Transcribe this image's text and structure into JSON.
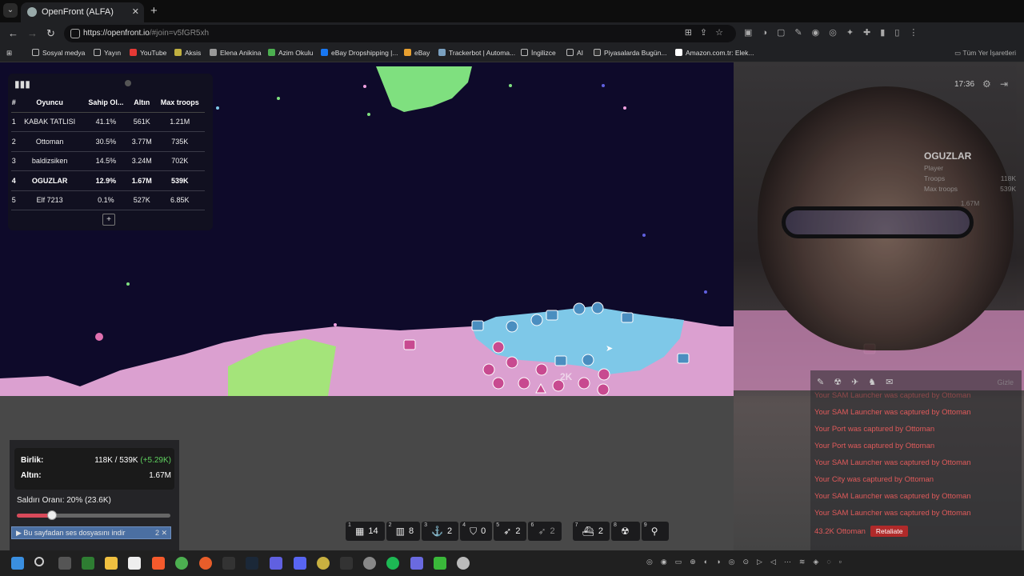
{
  "browser": {
    "tab_title": "OpenFront (ALFA)",
    "url_host": "https://openfront.io",
    "url_path": "/#join=v5fGR5xh",
    "bookmarks": [
      "Sosyal medya",
      "Yayın",
      "YouTube",
      "Aksis",
      "Elena Anikina",
      "Azim Okulu",
      "eBay Dropshipping |...",
      "eBay",
      "Trackerbot | Automa...",
      "İngilizce",
      "AI",
      "Piyasalarda Bugün...",
      "Amazon.com.tr: Elek..."
    ],
    "all_bookmarks": "Tüm Yer İşaretleri"
  },
  "leaderboard": {
    "headers": [
      "#",
      "Oyuncu",
      "Sahip Ol...",
      "Altın",
      "Max troops"
    ],
    "rows": [
      [
        "1",
        "KABAK TATLISI",
        "41.1%",
        "561K",
        "1.21M"
      ],
      [
        "2",
        "Ottoman",
        "30.5%",
        "3.77M",
        "735K"
      ],
      [
        "3",
        "baldizsiken",
        "14.5%",
        "3.24M",
        "702K"
      ],
      [
        "4",
        "OGUZLAR",
        "12.9%",
        "1.67M",
        "539K"
      ],
      [
        "5",
        "Elf 7213",
        "0.1%",
        "527K",
        "6.85K"
      ]
    ],
    "more_label": "+"
  },
  "overlay": {
    "clock": "17:36",
    "player_name": "OGUZLAR",
    "player_type": "Player",
    "troops_label": "Troops",
    "troops_value": "118K",
    "max_troops_label": "Max troops",
    "max_troops_value": "539K",
    "gold_value": "1.67M"
  },
  "events": {
    "hide_label": "Gizle",
    "lines": [
      "Your SAM Launcher was captured by Ottoman",
      "Your SAM Launcher was captured by Ottoman",
      "Your Port was captured by Ottoman",
      "Your Port was captured by Ottoman",
      "Your SAM Launcher was captured by Ottoman",
      "Your City was captured by Ottoman",
      "Your SAM Launcher was captured by Ottoman",
      "Your SAM Launcher was captured by Ottoman"
    ],
    "attack_line": "43.2K Ottoman",
    "retaliate_label": "Retaliate"
  },
  "stats": {
    "troops_label": "Birlik:",
    "troops_value": "118K / 539K",
    "troops_delta": "(+5.29K)",
    "gold_label": "Altın:",
    "gold_value": "1.67M",
    "attack_ratio_text": "Saldırı Oranı: 20% (23.6K)",
    "attack_ratio": 0.2,
    "sound_banner": "Bu sayfadan ses dosyasını indir"
  },
  "map": {
    "center_label": "2K"
  },
  "buildbar": [
    {
      "key": "1",
      "icon": "city-icon",
      "glyph": "▦",
      "count": "14"
    },
    {
      "key": "2",
      "icon": "factory-icon",
      "glyph": "▥",
      "count": "8"
    },
    {
      "key": "3",
      "icon": "port-icon",
      "glyph": "⚓",
      "count": "2"
    },
    {
      "key": "4",
      "icon": "defense-post-icon",
      "glyph": "⛉",
      "count": "0"
    },
    {
      "key": "5",
      "icon": "missile-silo-icon",
      "glyph": "➶",
      "count": "2"
    },
    {
      "key": "6",
      "icon": "sam-launcher-icon",
      "glyph": "➶",
      "count": "2"
    },
    {
      "key": "7",
      "icon": "warship-icon",
      "glyph": "⛴",
      "count": "2"
    },
    {
      "key": "8",
      "icon": "nuke-icon",
      "glyph": "☢",
      "count": ""
    },
    {
      "key": "9",
      "icon": "mirv-icon",
      "glyph": "⚲",
      "count": ""
    }
  ]
}
